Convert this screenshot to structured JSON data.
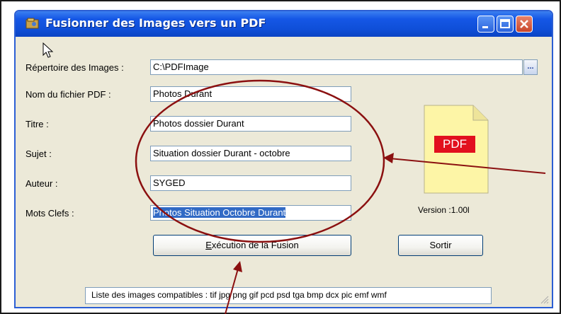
{
  "window": {
    "title": "Fusionner des Images vers un PDF"
  },
  "form": {
    "image_dir_label": "Répertoire des Images :",
    "image_dir_value": "C:\\PDFImage",
    "browse_label": "...",
    "pdf_name_label": "Nom du fichier PDF :",
    "pdf_name_value": "Photos Durant",
    "title_label": "Titre :",
    "title_value": "Photos dossier Durant",
    "subject_label": "Sujet :",
    "subject_value": "Situation dossier Durant - octobre",
    "author_label": "Auteur :",
    "author_value": "SYGED",
    "keywords_label": "Mots Clefs :",
    "keywords_value": "Photos Situation Octobre Durant"
  },
  "pdf_badge": "PDF",
  "version_text": "Version :1.00l",
  "buttons": {
    "execute": "Exécution de la Fusion",
    "exit": "Sortir"
  },
  "formats_text": "Liste des images compatibles : tif jpg png gif pcd psd tga bmp dcx pic emf wmf",
  "colors": {
    "titlebar": "#0f4fd8",
    "annotation": "#8b1010",
    "pdf_badge": "#e2101e",
    "pdf_page": "#fdf5a6"
  }
}
